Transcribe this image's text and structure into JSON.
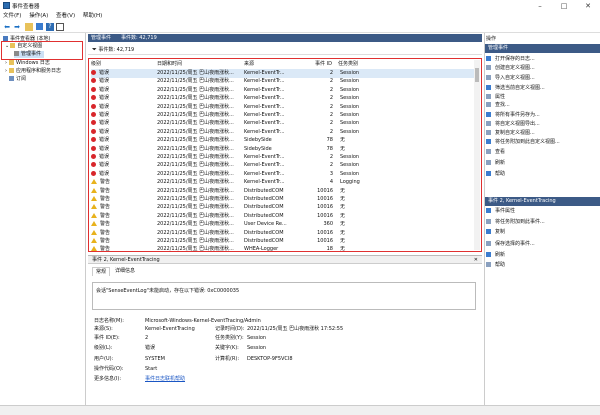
{
  "window": {
    "title": "事件查看器",
    "min_icon": "minimize-icon",
    "max_icon": "maximize-icon",
    "close_icon": "close-icon"
  },
  "menu": [
    "文件(F)",
    "操作(A)",
    "查看(V)",
    "帮助(H)"
  ],
  "toolbar_icons": [
    "back-icon",
    "forward-icon",
    "folder-icon",
    "refresh-icon",
    "help-icon",
    "panel-icon"
  ],
  "tree": {
    "root": "事件查看器 (本地)",
    "custom_views": "自定义视图",
    "admin_events": "管理事件",
    "windows_logs": "Windows 日志",
    "app_service_logs": "应用程序和服务日志",
    "subscriptions": "订阅"
  },
  "main": {
    "header": "管理事件",
    "header_count": "事件数: 42,719",
    "events_label": "事件数: 42,719"
  },
  "columns": [
    "级别",
    "日期和时间",
    "来源",
    "事件 ID",
    "任务类别"
  ],
  "rows": [
    {
      "level": "错误",
      "time": "2022/11/25/周五 巴山夜雨涨秋...",
      "source": "Kernel-EventTr...",
      "id": "2",
      "task": "Session"
    },
    {
      "level": "错误",
      "time": "2022/11/25/周五 巴山夜雨涨秋...",
      "source": "Kernel-EventTr...",
      "id": "2",
      "task": "Session"
    },
    {
      "level": "错误",
      "time": "2022/11/25/周五 巴山夜雨涨秋...",
      "source": "Kernel-EventTr...",
      "id": "2",
      "task": "Session"
    },
    {
      "level": "错误",
      "time": "2022/11/25/周五 巴山夜雨涨秋...",
      "source": "Kernel-EventTr...",
      "id": "2",
      "task": "Session"
    },
    {
      "level": "错误",
      "time": "2022/11/25/周五 巴山夜雨涨秋...",
      "source": "Kernel-EventTr...",
      "id": "2",
      "task": "Session"
    },
    {
      "level": "错误",
      "time": "2022/11/25/周五 巴山夜雨涨秋...",
      "source": "Kernel-EventTr...",
      "id": "2",
      "task": "Session"
    },
    {
      "level": "错误",
      "time": "2022/11/25/周五 巴山夜雨涨秋...",
      "source": "Kernel-EventTr...",
      "id": "2",
      "task": "Session"
    },
    {
      "level": "错误",
      "time": "2022/11/25/周五 巴山夜雨涨秋...",
      "source": "Kernel-EventTr...",
      "id": "2",
      "task": "Session"
    },
    {
      "level": "错误",
      "time": "2022/11/25/周五 巴山夜雨涨秋...",
      "source": "SidebySide",
      "id": "78",
      "task": "无"
    },
    {
      "level": "错误",
      "time": "2022/11/25/周五 巴山夜雨涨秋...",
      "source": "SidebySide",
      "id": "78",
      "task": "无"
    },
    {
      "level": "错误",
      "time": "2022/11/25/周五 巴山夜雨涨秋...",
      "source": "Kernel-EventTr...",
      "id": "2",
      "task": "Session"
    },
    {
      "level": "错误",
      "time": "2022/11/25/周五 巴山夜雨涨秋...",
      "source": "Kernel-EventTr...",
      "id": "2",
      "task": "Session"
    },
    {
      "level": "错误",
      "time": "2022/11/25/周五 巴山夜雨涨秋...",
      "source": "Kernel-EventTr...",
      "id": "3",
      "task": "Session"
    },
    {
      "level": "警告",
      "time": "2022/11/25/周五 巴山夜雨涨秋...",
      "source": "Kernel-EventTr...",
      "id": "4",
      "task": "Logging"
    },
    {
      "level": "警告",
      "time": "2022/11/25/周五 巴山夜雨涨秋...",
      "source": "DistributedCOM",
      "id": "10016",
      "task": "无"
    },
    {
      "level": "警告",
      "time": "2022/11/25/周五 巴山夜雨涨秋...",
      "source": "DistributedCOM",
      "id": "10016",
      "task": "无"
    },
    {
      "level": "警告",
      "time": "2022/11/25/周五 巴山夜雨涨秋...",
      "source": "DistributedCOM",
      "id": "10016",
      "task": "无"
    },
    {
      "level": "警告",
      "time": "2022/11/25/周五 巴山夜雨涨秋...",
      "source": "DistributedCOM",
      "id": "10016",
      "task": "无"
    },
    {
      "level": "警告",
      "time": "2022/11/25/周五 巴山夜雨涨秋...",
      "source": "User Device Re...",
      "id": "360",
      "task": "无"
    },
    {
      "level": "警告",
      "time": "2022/11/25/周五 巴山夜雨涨秋...",
      "source": "DistributedCOM",
      "id": "10016",
      "task": "无"
    },
    {
      "level": "警告",
      "time": "2022/11/25/周五 巴山夜雨涨秋...",
      "source": "DistributedCOM",
      "id": "10016",
      "task": "无"
    },
    {
      "level": "警告",
      "time": "2022/11/25/周五 巴山夜雨涨秋...",
      "source": "WHEA-Logger",
      "id": "18",
      "task": "无"
    }
  ],
  "detail": {
    "header": "事件 2, Kernel-EventTracing",
    "tab_general": "常规",
    "tab_details": "详细信息",
    "message": "会话\"SenseEventLog\"未能启动，存在以下错误: 0xC0000035",
    "log_name_label": "日志名称(M):",
    "log_name": "Microsoft-Windows-Kernel-EventTracing/Admin",
    "source_label": "来源(S):",
    "source": "Kernel-EventTracing",
    "logged_label": "记录时间(D):",
    "logged": "2022/11/25/周五 巴山夜雨涨秋 17:52:55",
    "event_id_label": "事件 ID(E):",
    "event_id": "2",
    "task_label": "任务类别(Y):",
    "task": "Session",
    "level_label": "级别(L):",
    "level": "错误",
    "keywords_label": "关键字(K):",
    "keywords": "Session",
    "user_label": "用户(U):",
    "user": "SYSTEM",
    "computer_label": "计算机(R):",
    "computer": "DESKTOP-9F5VCI8",
    "opcode_label": "操作代码(O):",
    "opcode": "Start",
    "more_label": "更多信息(I):",
    "more_link": "事件日志联机帮助"
  },
  "actions": {
    "title": "操作",
    "section1": "管理事件",
    "items1": [
      "打开保存的日志...",
      "创建自定义视图...",
      "导入自定义视图...",
      "筛选当前自定义视图...",
      "属性",
      "查找...",
      "将所有事件另存为...",
      "将自定义视图导出...",
      "复制自定义视图...",
      "将任务附加到此自定义视图...",
      "查看",
      "刷新",
      "帮助"
    ],
    "section2": "事件 2, Kernel-EventTracing",
    "items2": [
      "事件属性",
      "将任务附加到此事件...",
      "复制",
      "保存选择的事件...",
      "刷新",
      "帮助"
    ]
  },
  "colors": {
    "header_blue": "#3c5a86",
    "error_red": "#d8262b",
    "warning_yellow": "#e8b21c",
    "highlight_red": "#e03030"
  }
}
